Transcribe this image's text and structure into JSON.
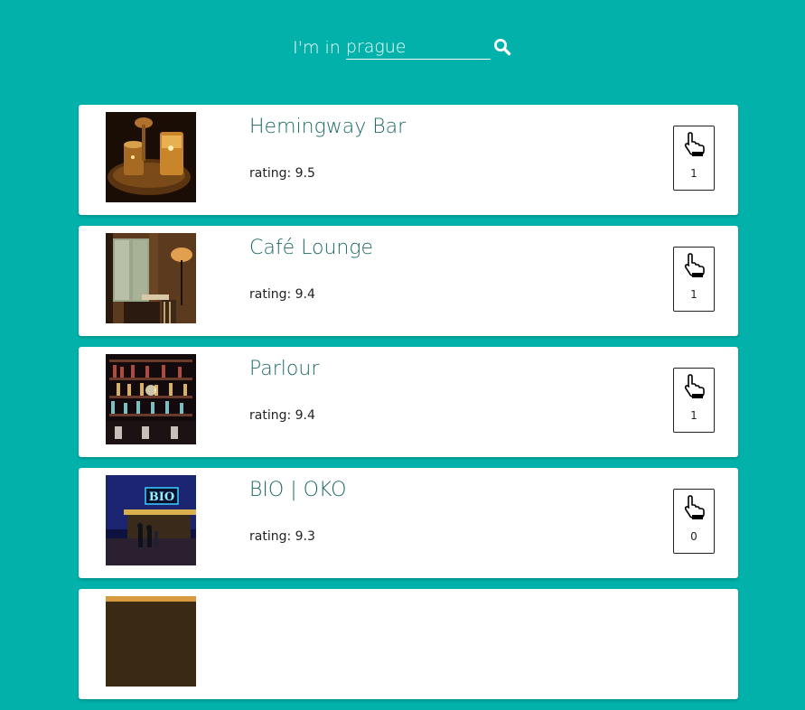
{
  "search": {
    "prefix": "I'm in",
    "value": "prague",
    "icon": "search-icon"
  },
  "venues": [
    {
      "name": "Hemingway Bar",
      "rating": "rating: 9.5",
      "likes": "1",
      "photo": "cocktail-glasses"
    },
    {
      "name": "Café Lounge",
      "rating": "rating: 9.4",
      "likes": "1",
      "photo": "cafe-window-interior"
    },
    {
      "name": "Parlour",
      "rating": "rating: 9.4",
      "likes": "1",
      "photo": "bar-shelves"
    },
    {
      "name": "BIO | OKO",
      "rating": "rating: 9.3",
      "likes": "0",
      "photo": "cinema-neon-sign"
    }
  ],
  "colors": {
    "background": "#02b2aa",
    "title": "#1e6a66",
    "card": "#ffffff"
  }
}
